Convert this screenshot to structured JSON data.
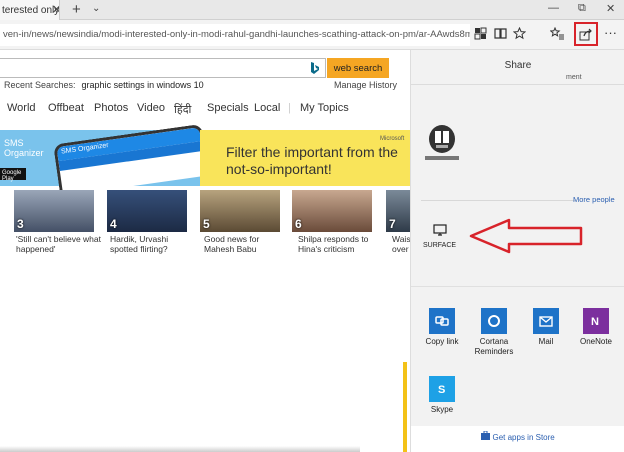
{
  "tab": {
    "title": "terested only in",
    "close": "✕",
    "new": "+",
    "menu": "⌄"
  },
  "window": {
    "minimize": "—",
    "restore": "⧉",
    "close": "✕"
  },
  "address": {
    "url": "ven-in/news/newsindia/modi-interested-only-in-modi-rahul-gandhi-launches-scathing-attack-on-pm/ar-AAwds8m?li=AAaeRVN&o"
  },
  "toolbar": {
    "more": "···"
  },
  "search": {
    "button": "web search",
    "recent_label": "Recent Searches:",
    "recent_query": "graphic settings in windows 10",
    "manage": "Manage History"
  },
  "nav": {
    "items": [
      "World",
      "Offbeat",
      "Photos",
      "Video",
      "हिंदी",
      "Specials",
      "Local",
      "My Topics"
    ]
  },
  "banner": {
    "brand": "SMS\nOrganizer",
    "store": "Google Play",
    "phone_title": "SMS Organizer",
    "headline": "Filter the important from the not-so-important!",
    "sponsor": "Microsoft"
  },
  "stories": [
    {
      "num": "3",
      "caption": "'Still can't believe what happened'"
    },
    {
      "num": "4",
      "caption": "Hardik, Urvashi spotted flirting?"
    },
    {
      "num": "5",
      "caption": "Good news for Mahesh Babu"
    },
    {
      "num": "6",
      "caption": "Shilpa responds to Hina's criticism"
    },
    {
      "num": "7",
      "caption": "Wais over"
    }
  ],
  "share": {
    "title": "Share",
    "subtitle": "ment",
    "more_people": "More people",
    "device": "SURFACE",
    "apps": [
      {
        "label": "Copy link",
        "color": "#1e73c8",
        "icon": "copy-link-icon"
      },
      {
        "label": "Cortana Reminders",
        "color": "#1e73c8",
        "icon": "cortana-icon"
      },
      {
        "label": "Mail",
        "color": "#1e73c8",
        "icon": "mail-icon"
      },
      {
        "label": "OneNote",
        "color": "#7c2f9e",
        "icon": "onenote-icon"
      },
      {
        "label": "Skype",
        "color": "#1ea1e6",
        "icon": "skype-icon"
      }
    ],
    "get_apps": "Get apps in Store"
  }
}
